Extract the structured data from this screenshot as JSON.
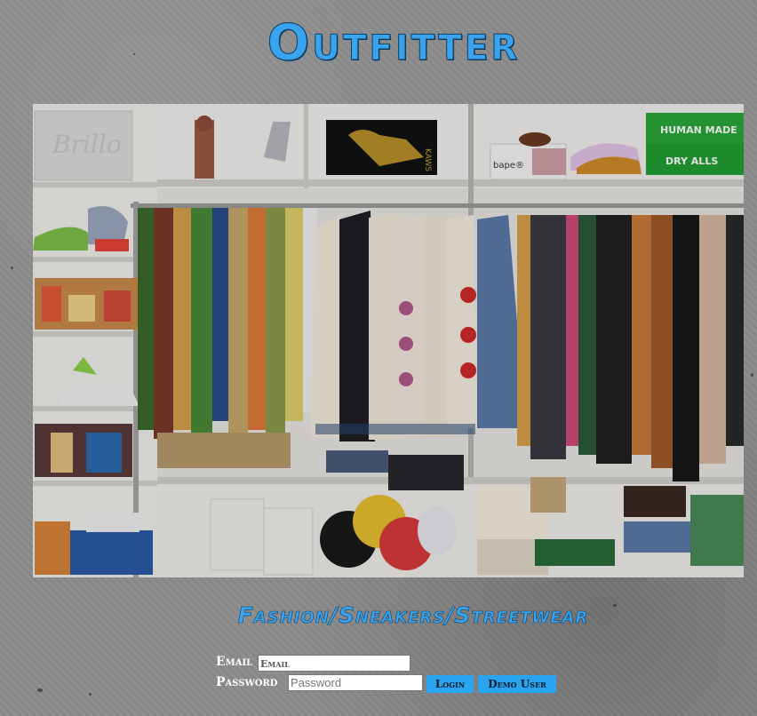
{
  "app": {
    "title": "Outfitter",
    "tagline": "Fashion/Sneakers/Streetwear"
  },
  "hero": {
    "description": "closet-with-clothes-and-sneakers-photo",
    "signs": [
      "HUMAN MADE",
      "DRY ALLS",
      "KAWS",
      "bape"
    ]
  },
  "login": {
    "email_label": "Email",
    "email_placeholder": "Email",
    "password_label": "Password",
    "password_placeholder": "Password",
    "login_button": "Login",
    "demo_button": "Demo User"
  },
  "colors": {
    "accent": "#3aa3ee",
    "button": "#28a4f1",
    "background": "#8b8b8b"
  }
}
